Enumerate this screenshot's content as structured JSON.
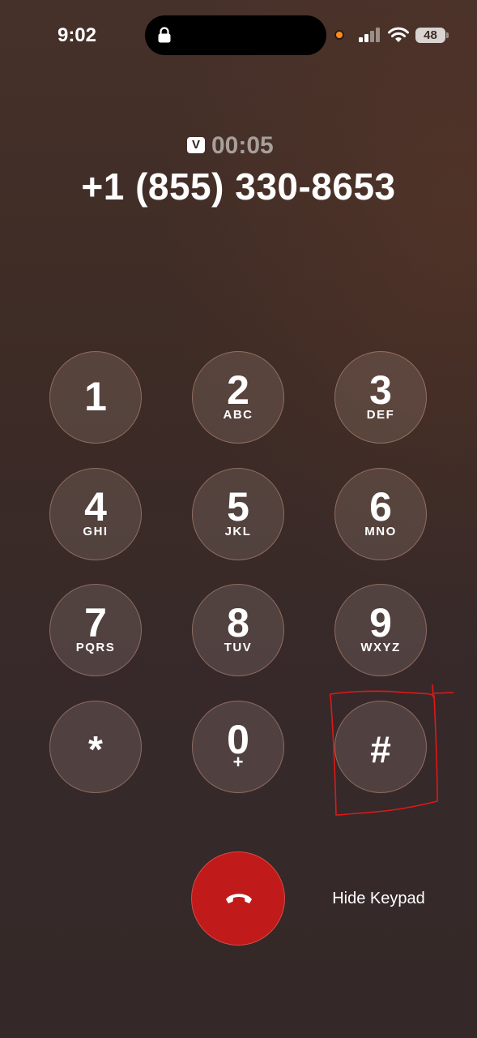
{
  "status_bar": {
    "time": "9:02",
    "battery_level": "48"
  },
  "call": {
    "badge": "V",
    "duration": "00:05",
    "phone_number": "+1 (855) 330-8653"
  },
  "keypad": [
    {
      "digit": "1",
      "letters": ""
    },
    {
      "digit": "2",
      "letters": "ABC"
    },
    {
      "digit": "3",
      "letters": "DEF"
    },
    {
      "digit": "4",
      "letters": "GHI"
    },
    {
      "digit": "5",
      "letters": "JKL"
    },
    {
      "digit": "6",
      "letters": "MNO"
    },
    {
      "digit": "7",
      "letters": "PQRS"
    },
    {
      "digit": "8",
      "letters": "TUV"
    },
    {
      "digit": "9",
      "letters": "WXYZ"
    },
    {
      "digit": "*",
      "letters": ""
    },
    {
      "digit": "0",
      "letters": "+"
    },
    {
      "digit": "#",
      "letters": ""
    }
  ],
  "controls": {
    "hide_keypad_label": "Hide Keypad",
    "end_call_icon": "phone-hangup-icon"
  },
  "colors": {
    "end_call": "#c01a1a",
    "recording_dot": "#ff8a1e",
    "annotation": "#e01818"
  }
}
